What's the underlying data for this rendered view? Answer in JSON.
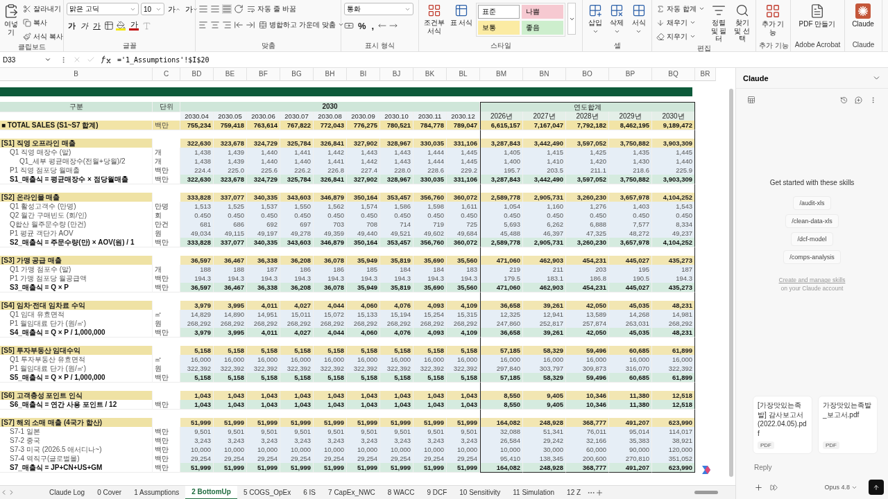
{
  "ribbon": {
    "groups": [
      {
        "kind": "clipboard",
        "label": "클립보드",
        "paste": "여넣기",
        "items": [
          "잘라내기",
          "복사",
          "서식 복사"
        ]
      },
      {
        "kind": "font",
        "label": "글꼴",
        "font": "맑은 고딕",
        "size": "10",
        "grow": "가",
        "shrink": "가",
        "styles": [
          "가",
          "가",
          "가"
        ],
        "color_letter": "가"
      },
      {
        "kind": "align",
        "label": "맞춤",
        "wrap": "자동 줄 바꿈",
        "merge": "병합하고 가운데 맞춤"
      },
      {
        "kind": "number",
        "label": "표시 형식",
        "format": "통화",
        "symbols": [
          "%",
          ","
        ]
      },
      {
        "kind": "styles",
        "label": "스타일",
        "buttons": [
          "조건부 서식",
          "표 서식"
        ],
        "cells": [
          {
            "text": "표준",
            "color": "#ffffff"
          },
          {
            "text": "나쁨",
            "color": "#f6c9d1"
          },
          {
            "text": "보통",
            "color": "#fbeba3"
          },
          {
            "text": "좋음",
            "color": "#cdeecd"
          }
        ]
      },
      {
        "kind": "cells",
        "label": "셀",
        "buttons": [
          "삽입",
          "삭제",
          "서식"
        ]
      },
      {
        "kind": "editing",
        "label": "편집",
        "items": [
          "자동 합계",
          "채우기",
          "지우기"
        ],
        "buttons": [
          "정렬 및 필터",
          "찾기 및 선택"
        ]
      },
      {
        "kind": "addins",
        "label": "추가 기능",
        "button": "추가 기능"
      },
      {
        "kind": "acrobat",
        "label": "Adobe Acrobat",
        "button": "PDF 만들기"
      },
      {
        "kind": "claude",
        "label": "Claude",
        "button": "Claude"
      }
    ]
  },
  "formula_bar": {
    "name_box": "D33",
    "formula": "='1_Assumptions'!$I$20"
  },
  "columns": [
    "B",
    "C",
    "BD",
    "BE",
    "BF",
    "BG",
    "BH",
    "BI",
    "BJ",
    "BK",
    "BL",
    "BM",
    "BN",
    "BO",
    "BP",
    "BQ",
    "BR"
  ],
  "table": {
    "header": {
      "label": "구분",
      "unit": "단위",
      "month_group": "2030",
      "year_group": "연도합계",
      "months": [
        "2030.04",
        "2030.05",
        "2030.06",
        "2030.07",
        "2030.08",
        "2030.09",
        "2030.10",
        "2030.11",
        "2030.12"
      ],
      "years": [
        "2026년",
        "2027년",
        "2028년",
        "2029년",
        "2030년"
      ]
    },
    "rows": [
      {
        "kind": "total",
        "label": "■ TOTAL SALES (S1~S7 합계)",
        "unit": "백만",
        "monthly": [
          "755,234",
          "759,418",
          "763,614",
          "767,822",
          "772,043",
          "776,275",
          "780,521",
          "784,778",
          "789,047"
        ],
        "yearly": [
          "6,615,157",
          "7,167,047",
          "7,792,182",
          "8,462,195",
          "9,189,472"
        ]
      },
      {
        "kind": "blank"
      },
      {
        "kind": "section",
        "label": "[S1] 직영 오프라인 매출",
        "monthly": [
          "322,630",
          "323,678",
          "324,729",
          "325,784",
          "326,841",
          "327,902",
          "328,967",
          "330,035",
          "331,106"
        ],
        "yearly": [
          "3,287,843",
          "3,442,490",
          "3,597,052",
          "3,750,882",
          "3,903,309"
        ]
      },
      {
        "kind": "item",
        "label": "Q1 직영 매장수 (말)",
        "unit": "개",
        "monthly": [
          "1,438",
          "1,439",
          "1,440",
          "1,441",
          "1,442",
          "1,443",
          "1,443",
          "1,444",
          "1,445"
        ],
        "yearly": [
          "1,405",
          "1,415",
          "1,425",
          "1,435",
          "1,445"
        ]
      },
      {
        "kind": "subitem",
        "label": "Q1_세부 평균매장수(전월+당월)/2",
        "unit": "개",
        "monthly": [
          "1,438",
          "1,439",
          "1,440",
          "1,440",
          "1,441",
          "1,442",
          "1,443",
          "1,444",
          "1,445"
        ],
        "yearly": [
          "1,400",
          "1,410",
          "1,420",
          "1,430",
          "1,440"
        ]
      },
      {
        "kind": "item",
        "label": "P1 직영 점포당 월매출",
        "unit": "백만",
        "monthly": [
          "224.4",
          "225.0",
          "225.6",
          "226.2",
          "226.8",
          "227.4",
          "228.0",
          "228.6",
          "229.2"
        ],
        "yearly": [
          "195.7",
          "203.5",
          "211.1",
          "218.6",
          "225.9"
        ]
      },
      {
        "kind": "formula",
        "label": "S1_매출식 = 평균매장수 × 점당월매출",
        "unit": "백만",
        "monthly": [
          "322,630",
          "323,678",
          "324,729",
          "325,784",
          "326,841",
          "327,902",
          "328,967",
          "330,035",
          "331,106"
        ],
        "yearly": [
          "3,287,843",
          "3,442,490",
          "3,597,052",
          "3,750,882",
          "3,903,309"
        ]
      },
      {
        "kind": "blank"
      },
      {
        "kind": "section",
        "label": "[S2] 온라인몰 매출",
        "monthly": [
          "333,828",
          "337,077",
          "340,335",
          "343,603",
          "346,879",
          "350,164",
          "353,457",
          "356,760",
          "360,072"
        ],
        "yearly": [
          "2,589,778",
          "2,905,731",
          "3,260,230",
          "3,657,978",
          "4,104,252"
        ]
      },
      {
        "kind": "item",
        "label": "Q1 활성고객수 (만명)",
        "unit": "만명",
        "monthly": [
          "1,513",
          "1,525",
          "1,537",
          "1,550",
          "1,562",
          "1,574",
          "1,586",
          "1,598",
          "1,611"
        ],
        "yearly": [
          "1,054",
          "1,160",
          "1,276",
          "1,403",
          "1,543"
        ]
      },
      {
        "kind": "item",
        "label": "Q2 월간 구매빈도 (회/인)",
        "unit": "회",
        "monthly": [
          "0.450",
          "0.450",
          "0.450",
          "0.450",
          "0.450",
          "0.450",
          "0.450",
          "0.450",
          "0.450"
        ],
        "yearly": [
          "0.450",
          "0.450",
          "0.450",
          "0.450",
          "0.450"
        ]
      },
      {
        "kind": "item",
        "label": "Q합산 월주문수량 (만건)",
        "unit": "만건",
        "monthly": [
          "681",
          "686",
          "692",
          "697",
          "703",
          "708",
          "714",
          "719",
          "725"
        ],
        "yearly": [
          "5,693",
          "6,262",
          "6,888",
          "7,577",
          "8,334"
        ]
      },
      {
        "kind": "item",
        "label": "P1 평균 객단가 AOV",
        "unit": "원",
        "monthly": [
          "49,034",
          "49,115",
          "49,197",
          "49,278",
          "49,359",
          "49,440",
          "49,521",
          "49,602",
          "49,684"
        ],
        "yearly": [
          "45,488",
          "46,397",
          "47,325",
          "48,272",
          "49,237"
        ]
      },
      {
        "kind": "formula",
        "label": "S2_매출식 = 주문수량(만) × AOV(원) / 1",
        "unit": "백만",
        "monthly": [
          "333,828",
          "337,077",
          "340,335",
          "343,603",
          "346,879",
          "350,164",
          "353,457",
          "356,760",
          "360,072"
        ],
        "yearly": [
          "2,589,778",
          "2,905,731",
          "3,260,230",
          "3,657,978",
          "4,104,252"
        ]
      },
      {
        "kind": "blank"
      },
      {
        "kind": "section",
        "label": "[S3] 가맹 공급 매출",
        "monthly": [
          "36,597",
          "36,467",
          "36,338",
          "36,208",
          "36,078",
          "35,949",
          "35,819",
          "35,690",
          "35,560"
        ],
        "yearly": [
          "471,060",
          "462,903",
          "454,231",
          "445,027",
          "435,273"
        ]
      },
      {
        "kind": "item",
        "label": "Q1 가맹 점포수 (말)",
        "unit": "개",
        "monthly": [
          "188",
          "188",
          "187",
          "186",
          "186",
          "185",
          "184",
          "184",
          "183"
        ],
        "yearly": [
          "219",
          "211",
          "203",
          "195",
          "187"
        ]
      },
      {
        "kind": "item",
        "label": "P1 가맹 점포당 월공급액",
        "unit": "백만",
        "monthly": [
          "194.3",
          "194.3",
          "194.3",
          "194.3",
          "194.3",
          "194.3",
          "194.3",
          "194.3",
          "194.3"
        ],
        "yearly": [
          "179.5",
          "183.1",
          "186.8",
          "190.5",
          "194.3"
        ]
      },
      {
        "kind": "formula",
        "label": "S3_매출식 = Q × P",
        "unit": "백만",
        "monthly": [
          "36,597",
          "36,467",
          "36,338",
          "36,208",
          "36,078",
          "35,949",
          "35,819",
          "35,690",
          "35,560"
        ],
        "yearly": [
          "471,060",
          "462,903",
          "454,231",
          "445,027",
          "435,273"
        ]
      },
      {
        "kind": "blank"
      },
      {
        "kind": "section",
        "label": "[S4] 임차·전대 임차료 수익",
        "monthly": [
          "3,979",
          "3,995",
          "4,011",
          "4,027",
          "4,044",
          "4,060",
          "4,076",
          "4,093",
          "4,109"
        ],
        "yearly": [
          "36,658",
          "39,261",
          "42,050",
          "45,035",
          "48,231"
        ]
      },
      {
        "kind": "item",
        "label": "Q1 임대 유효면적",
        "unit": "㎡",
        "monthly": [
          "14,829",
          "14,890",
          "14,951",
          "15,011",
          "15,072",
          "15,133",
          "15,194",
          "15,254",
          "15,315"
        ],
        "yearly": [
          "12,325",
          "12,941",
          "13,589",
          "14,268",
          "14,981"
        ]
      },
      {
        "kind": "item",
        "label": "P1 월임대료 단가 (원/㎡)",
        "unit": "원",
        "monthly": [
          "268,292",
          "268,292",
          "268,292",
          "268,292",
          "268,292",
          "268,292",
          "268,292",
          "268,292",
          "268,292"
        ],
        "yearly": [
          "247,860",
          "252,817",
          "257,874",
          "263,031",
          "268,292"
        ]
      },
      {
        "kind": "formula",
        "label": "S4_매출식 = Q × P / 1,000,000",
        "unit": "백만",
        "monthly": [
          "3,979",
          "3,995",
          "4,011",
          "4,027",
          "4,044",
          "4,060",
          "4,076",
          "4,093",
          "4,109"
        ],
        "yearly": [
          "36,658",
          "39,261",
          "42,050",
          "45,035",
          "48,231"
        ]
      },
      {
        "kind": "blank"
      },
      {
        "kind": "section",
        "label": "[S5] 투자부동산 임대수익",
        "monthly": [
          "5,158",
          "5,158",
          "5,158",
          "5,158",
          "5,158",
          "5,158",
          "5,158",
          "5,158",
          "5,158"
        ],
        "yearly": [
          "57,185",
          "58,329",
          "59,496",
          "60,685",
          "61,899"
        ]
      },
      {
        "kind": "item",
        "label": "Q1 투자부동산 유효면적",
        "unit": "㎡",
        "monthly": [
          "16,000",
          "16,000",
          "16,000",
          "16,000",
          "16,000",
          "16,000",
          "16,000",
          "16,000",
          "16,000"
        ],
        "yearly": [
          "16,000",
          "16,000",
          "16,000",
          "16,000",
          "16,000"
        ]
      },
      {
        "kind": "item",
        "label": "P1 월임대료 단가 (원/㎡)",
        "unit": "원",
        "monthly": [
          "322,392",
          "322,392",
          "322,392",
          "322,392",
          "322,392",
          "322,392",
          "322,392",
          "322,392",
          "322,392"
        ],
        "yearly": [
          "297,840",
          "303,797",
          "309,873",
          "316,070",
          "322,392"
        ]
      },
      {
        "kind": "formula",
        "label": "S5_매출식 = Q × P / 1,000,000",
        "unit": "백만",
        "monthly": [
          "5,158",
          "5,158",
          "5,158",
          "5,158",
          "5,158",
          "5,158",
          "5,158",
          "5,158",
          "5,158"
        ],
        "yearly": [
          "57,185",
          "58,329",
          "59,496",
          "60,685",
          "61,899"
        ]
      },
      {
        "kind": "blank"
      },
      {
        "kind": "section",
        "label": "[S6] 고객충성 포인트 인식",
        "monthly": [
          "1,043",
          "1,043",
          "1,043",
          "1,043",
          "1,043",
          "1,043",
          "1,043",
          "1,043",
          "1,043"
        ],
        "yearly": [
          "8,550",
          "9,405",
          "10,346",
          "11,380",
          "12,518"
        ]
      },
      {
        "kind": "formula",
        "label": "S6_매출식 = 연간 사용 포인트 / 12",
        "unit": "백만",
        "monthly": [
          "1,043",
          "1,043",
          "1,043",
          "1,043",
          "1,043",
          "1,043",
          "1,043",
          "1,043",
          "1,043"
        ],
        "yearly": [
          "8,550",
          "9,405",
          "10,346",
          "11,380",
          "12,518"
        ]
      },
      {
        "kind": "blank"
      },
      {
        "kind": "section",
        "label": "[S7] 해외 소매 매출 (4국가 합산)",
        "monthly": [
          "51,999",
          "51,999",
          "51,999",
          "51,999",
          "51,999",
          "51,999",
          "51,999",
          "51,999",
          "51,999"
        ],
        "yearly": [
          "164,082",
          "248,928",
          "368,777",
          "491,207",
          "623,990"
        ]
      },
      {
        "kind": "item",
        "label": "S7-1 일본",
        "unit": "백만",
        "monthly": [
          "9,501",
          "9,501",
          "9,501",
          "9,501",
          "9,501",
          "9,501",
          "9,501",
          "9,501",
          "9,501"
        ],
        "yearly": [
          "32,088",
          "51,341",
          "76,011",
          "95,014",
          "114,017"
        ]
      },
      {
        "kind": "item",
        "label": "S7-2 중국",
        "unit": "백만",
        "monthly": [
          "3,243",
          "3,243",
          "3,243",
          "3,243",
          "3,243",
          "3,243",
          "3,243",
          "3,243",
          "3,243"
        ],
        "yearly": [
          "26,584",
          "29,242",
          "32,166",
          "35,383",
          "38,921"
        ]
      },
      {
        "kind": "item",
        "label": "S7-3 미국 (2026.5 애서디나~)",
        "unit": "백만",
        "monthly": [
          "10,000",
          "10,000",
          "10,000",
          "10,000",
          "10,000",
          "10,000",
          "10,000",
          "10,000",
          "10,000"
        ],
        "yearly": [
          "10,000",
          "30,000",
          "60,000",
          "90,000",
          "120,000"
        ]
      },
      {
        "kind": "item",
        "label": "S7-4 역직구(글로벌몰)",
        "unit": "백만",
        "monthly": [
          "29,254",
          "29,254",
          "29,254",
          "29,254",
          "29,254",
          "29,254",
          "29,254",
          "29,254",
          "29,254"
        ],
        "yearly": [
          "95,410",
          "138,345",
          "200,600",
          "270,810",
          "351,052"
        ]
      },
      {
        "kind": "formula",
        "label": "S7_매출식 = JP+CN+US+GM",
        "unit": "백만",
        "monthly": [
          "51,999",
          "51,999",
          "51,999",
          "51,999",
          "51,999",
          "51,999",
          "51,999",
          "51,999",
          "51,999"
        ],
        "yearly": [
          "164,082",
          "248,928",
          "368,777",
          "491,207",
          "623,990"
        ]
      }
    ]
  },
  "sheet_tabs": [
    {
      "label": "Claude Log",
      "selected": false
    },
    {
      "label": "0 Cover",
      "selected": false
    },
    {
      "label": "1 Assumptions",
      "selected": false
    },
    {
      "label": "2 BottomUp",
      "selected": true
    },
    {
      "label": "5 COGS_OpEx",
      "selected": false
    },
    {
      "label": "6 IS",
      "selected": false
    },
    {
      "label": "7 CapEx_NWC",
      "selected": false
    },
    {
      "label": "8 WACC",
      "selected": false
    },
    {
      "label": "9 DCF",
      "selected": false
    },
    {
      "label": "10 Sensitivity",
      "selected": false
    },
    {
      "label": "11 Simulation",
      "selected": false
    },
    {
      "label": "12 Z",
      "selected": false
    }
  ],
  "claude_panel": {
    "title": "Claude",
    "heading": "Get started with these skills",
    "skills": [
      "/audit-xls",
      "/clean-data-xls",
      "/dcf-model",
      "/comps-analysis"
    ],
    "skills_link": "Create and manage skills",
    "skills_note": "on your Claude account",
    "attachments": [
      {
        "name": "[가장맛있는족발] 감사보고서 (2022.04.05).pdf",
        "type": "PDF"
      },
      {
        "name": "가장맛있는족발_보고서.pdf",
        "type": "PDF"
      }
    ],
    "reply": {
      "placeholder": "Reply"
    },
    "model": "Opus 4.8"
  }
}
